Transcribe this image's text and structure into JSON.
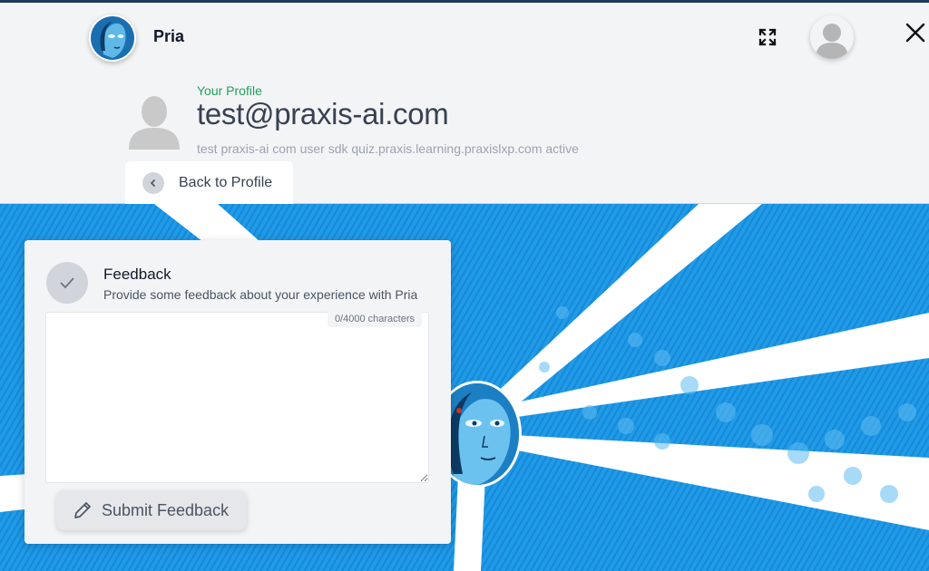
{
  "header": {
    "app_name": "Pria",
    "icons": {
      "app_avatar": "robot-face-avatar",
      "expand": "expand-icon",
      "user_avatar": "user-silhouette-icon",
      "close": "close-icon"
    }
  },
  "profile": {
    "label": "Your Profile",
    "email": "test@praxis-ai.com",
    "tags": "test praxis-ai com user sdk quiz.praxis.learning.praxislxp.com active",
    "back_label": "Back to Profile"
  },
  "feedback": {
    "title": "Feedback",
    "subtitle": "Provide some feedback about your experience with Pria",
    "char_count": "0/4000 characters",
    "textarea_value": "",
    "submit_label": "Submit Feedback",
    "icons": {
      "header": "check-icon",
      "submit": "pencil-icon"
    }
  },
  "colors": {
    "accent_green": "#22a05a",
    "hero_blue": "#1f9be8",
    "top_line": "#1e3a5f"
  }
}
